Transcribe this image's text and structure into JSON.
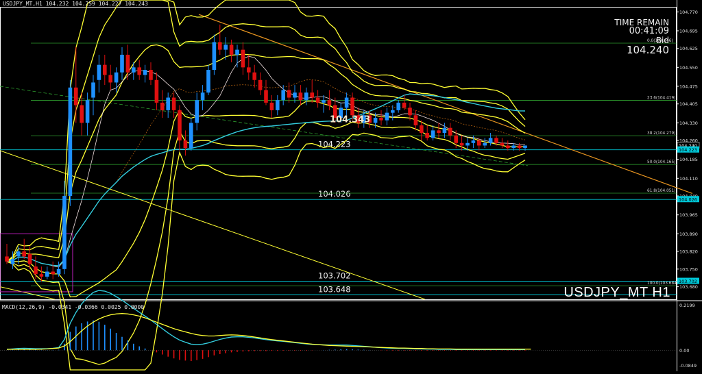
{
  "header": {
    "symbol_info": "USDJPY_MT,H1",
    "ohlc": "104.232 104.259 104.227 104.243"
  },
  "overlay": {
    "time_remain_label": "TIME REMAIN",
    "time_remain_value": "00:41:09",
    "bid_label": "Bid",
    "bid_value": "104.240",
    "symbol_watermark": "USDJPY_MT H1"
  },
  "colors": {
    "background": "#000000",
    "bull_candle": "#1e90ff",
    "bear_candle": "#e01010",
    "yellow_band": "#ffff33",
    "ma_cyan": "#33ccdd",
    "trendline_orange": "#e89520",
    "level_line_cyan": "#00c8d8",
    "fib_green": "#2e9e2e",
    "box_magenta": "#c020c0"
  },
  "chart_data": {
    "type": "candlestick",
    "price_axis": {
      "ylim": [
        103.63,
        104.79
      ],
      "tick_labels": [
        "104.770",
        "104.695",
        "104.625",
        "104.550",
        "104.475",
        "104.405",
        "104.330",
        "104.260",
        "104.185",
        "104.110",
        "104.040",
        "103.965",
        "103.890",
        "103.820",
        "103.750",
        "103.680"
      ]
    },
    "price_tags": [
      {
        "value": "104.240",
        "price": 104.24,
        "style": "bid"
      },
      {
        "value": "104.223",
        "price": 104.223,
        "style": "cyan"
      },
      {
        "value": "104.026",
        "price": 104.026,
        "style": "cyan"
      },
      {
        "value": "103.702",
        "price": 103.702,
        "style": "cyan"
      }
    ],
    "horizontal_levels": [
      {
        "label": "104.223",
        "price": 104.223
      },
      {
        "label": "104.026",
        "price": 104.026
      },
      {
        "label": "103.702",
        "price": 103.702
      },
      {
        "label": "103.648",
        "price": 103.648
      }
    ],
    "fibonacci_levels": [
      {
        "label": "0.0(104.646)",
        "price": 104.646
      },
      {
        "label": "23.6(104.419)",
        "price": 104.419
      },
      {
        "label": "38.2(104.279)",
        "price": 104.279
      },
      {
        "label": "50.0(104.165)",
        "price": 104.165
      },
      {
        "label": "61.8(104.051)",
        "price": 104.051
      },
      {
        "label": "100.0(103.684)",
        "price": 103.684
      }
    ],
    "annotation": {
      "text": "104.343",
      "price": 104.343
    },
    "candles": [
      {
        "o": 103.8,
        "h": 103.85,
        "l": 103.77,
        "c": 103.78
      },
      {
        "o": 103.77,
        "h": 103.82,
        "l": 103.75,
        "c": 103.79
      },
      {
        "o": 103.8,
        "h": 103.84,
        "l": 103.77,
        "c": 103.82
      },
      {
        "o": 103.82,
        "h": 103.87,
        "l": 103.79,
        "c": 103.8
      },
      {
        "o": 103.81,
        "h": 103.84,
        "l": 103.75,
        "c": 103.77
      },
      {
        "o": 103.76,
        "h": 103.8,
        "l": 103.71,
        "c": 103.73
      },
      {
        "o": 103.73,
        "h": 103.76,
        "l": 103.7,
        "c": 103.72
      },
      {
        "o": 103.72,
        "h": 103.76,
        "l": 103.71,
        "c": 103.74
      },
      {
        "o": 103.74,
        "h": 103.78,
        "l": 103.71,
        "c": 103.73
      },
      {
        "o": 103.73,
        "h": 103.78,
        "l": 103.72,
        "c": 103.75
      },
      {
        "o": 103.75,
        "h": 104.1,
        "l": 103.73,
        "c": 104.04
      },
      {
        "o": 104.04,
        "h": 104.5,
        "l": 104.0,
        "c": 104.47
      },
      {
        "o": 104.47,
        "h": 104.63,
        "l": 104.33,
        "c": 104.4
      },
      {
        "o": 104.4,
        "h": 104.45,
        "l": 104.28,
        "c": 104.33
      },
      {
        "o": 104.33,
        "h": 104.45,
        "l": 104.28,
        "c": 104.42
      },
      {
        "o": 104.43,
        "h": 104.52,
        "l": 104.36,
        "c": 104.49
      },
      {
        "o": 104.5,
        "h": 104.6,
        "l": 104.45,
        "c": 104.56
      },
      {
        "o": 104.56,
        "h": 104.6,
        "l": 104.48,
        "c": 104.52
      },
      {
        "o": 104.52,
        "h": 104.56,
        "l": 104.46,
        "c": 104.49
      },
      {
        "o": 104.49,
        "h": 104.55,
        "l": 104.45,
        "c": 104.53
      },
      {
        "o": 104.53,
        "h": 104.63,
        "l": 104.5,
        "c": 104.6
      },
      {
        "o": 104.6,
        "h": 104.64,
        "l": 104.5,
        "c": 104.53
      },
      {
        "o": 104.53,
        "h": 104.57,
        "l": 104.5,
        "c": 104.55
      },
      {
        "o": 104.55,
        "h": 104.58,
        "l": 104.5,
        "c": 104.52
      },
      {
        "o": 104.52,
        "h": 104.56,
        "l": 104.49,
        "c": 104.54
      },
      {
        "o": 104.54,
        "h": 104.57,
        "l": 104.48,
        "c": 104.5
      },
      {
        "o": 104.5,
        "h": 104.53,
        "l": 104.38,
        "c": 104.41
      },
      {
        "o": 104.41,
        "h": 104.46,
        "l": 104.35,
        "c": 104.38
      },
      {
        "o": 104.38,
        "h": 104.45,
        "l": 104.35,
        "c": 104.43
      },
      {
        "o": 104.43,
        "h": 104.45,
        "l": 104.35,
        "c": 104.38
      },
      {
        "o": 104.38,
        "h": 104.4,
        "l": 104.22,
        "c": 104.26
      },
      {
        "o": 104.26,
        "h": 104.3,
        "l": 104.2,
        "c": 104.23
      },
      {
        "o": 104.23,
        "h": 104.35,
        "l": 104.22,
        "c": 104.33
      },
      {
        "o": 104.33,
        "h": 104.45,
        "l": 104.3,
        "c": 104.42
      },
      {
        "o": 104.42,
        "h": 104.48,
        "l": 104.38,
        "c": 104.45
      },
      {
        "o": 104.45,
        "h": 104.56,
        "l": 104.44,
        "c": 104.54
      },
      {
        "o": 104.54,
        "h": 104.68,
        "l": 104.52,
        "c": 104.65
      },
      {
        "o": 104.65,
        "h": 104.72,
        "l": 104.6,
        "c": 104.62
      },
      {
        "o": 104.62,
        "h": 104.67,
        "l": 104.58,
        "c": 104.64
      },
      {
        "o": 104.64,
        "h": 104.66,
        "l": 104.57,
        "c": 104.6
      },
      {
        "o": 104.6,
        "h": 104.64,
        "l": 104.55,
        "c": 104.62
      },
      {
        "o": 104.62,
        "h": 104.65,
        "l": 104.52,
        "c": 104.55
      },
      {
        "o": 104.55,
        "h": 104.6,
        "l": 104.5,
        "c": 104.53
      },
      {
        "o": 104.53,
        "h": 104.56,
        "l": 104.47,
        "c": 104.5
      },
      {
        "o": 104.5,
        "h": 104.53,
        "l": 104.44,
        "c": 104.46
      },
      {
        "o": 104.46,
        "h": 104.5,
        "l": 104.4,
        "c": 104.41
      },
      {
        "o": 104.41,
        "h": 104.44,
        "l": 104.35,
        "c": 104.38
      },
      {
        "o": 104.38,
        "h": 104.44,
        "l": 104.36,
        "c": 104.42
      },
      {
        "o": 104.42,
        "h": 104.48,
        "l": 104.4,
        "c": 104.46
      },
      {
        "o": 104.46,
        "h": 104.49,
        "l": 104.41,
        "c": 104.43
      },
      {
        "o": 104.43,
        "h": 104.48,
        "l": 104.41,
        "c": 104.45
      },
      {
        "o": 104.45,
        "h": 104.48,
        "l": 104.4,
        "c": 104.42
      },
      {
        "o": 104.42,
        "h": 104.47,
        "l": 104.4,
        "c": 104.45
      },
      {
        "o": 104.45,
        "h": 104.5,
        "l": 104.41,
        "c": 104.43
      },
      {
        "o": 104.43,
        "h": 104.46,
        "l": 104.39,
        "c": 104.41
      },
      {
        "o": 104.41,
        "h": 104.44,
        "l": 104.37,
        "c": 104.42
      },
      {
        "o": 104.42,
        "h": 104.46,
        "l": 104.38,
        "c": 104.4
      },
      {
        "o": 104.4,
        "h": 104.43,
        "l": 104.33,
        "c": 104.35
      },
      {
        "o": 104.35,
        "h": 104.41,
        "l": 104.33,
        "c": 104.39
      },
      {
        "o": 104.39,
        "h": 104.45,
        "l": 104.36,
        "c": 104.43
      },
      {
        "o": 104.43,
        "h": 104.45,
        "l": 104.34,
        "c": 104.36
      },
      {
        "o": 104.36,
        "h": 104.39,
        "l": 104.31,
        "c": 104.33
      },
      {
        "o": 104.33,
        "h": 104.38,
        "l": 104.31,
        "c": 104.36
      },
      {
        "o": 104.36,
        "h": 104.38,
        "l": 104.31,
        "c": 104.33
      },
      {
        "o": 104.33,
        "h": 104.37,
        "l": 104.31,
        "c": 104.35
      },
      {
        "o": 104.35,
        "h": 104.38,
        "l": 104.32,
        "c": 104.34
      },
      {
        "o": 104.34,
        "h": 104.39,
        "l": 104.32,
        "c": 104.37
      },
      {
        "o": 104.37,
        "h": 104.4,
        "l": 104.34,
        "c": 104.38
      },
      {
        "o": 104.38,
        "h": 104.42,
        "l": 104.37,
        "c": 104.41
      },
      {
        "o": 104.41,
        "h": 104.44,
        "l": 104.38,
        "c": 104.39
      },
      {
        "o": 104.39,
        "h": 104.41,
        "l": 104.34,
        "c": 104.36
      },
      {
        "o": 104.36,
        "h": 104.38,
        "l": 104.3,
        "c": 104.32
      },
      {
        "o": 104.32,
        "h": 104.34,
        "l": 104.26,
        "c": 104.29
      },
      {
        "o": 104.29,
        "h": 104.32,
        "l": 104.26,
        "c": 104.27
      },
      {
        "o": 104.27,
        "h": 104.32,
        "l": 104.26,
        "c": 104.3
      },
      {
        "o": 104.3,
        "h": 104.33,
        "l": 104.27,
        "c": 104.29
      },
      {
        "o": 104.29,
        "h": 104.33,
        "l": 104.27,
        "c": 104.31
      },
      {
        "o": 104.31,
        "h": 104.33,
        "l": 104.26,
        "c": 104.28
      },
      {
        "o": 104.28,
        "h": 104.3,
        "l": 104.23,
        "c": 104.25
      },
      {
        "o": 104.25,
        "h": 104.28,
        "l": 104.22,
        "c": 104.24
      },
      {
        "o": 104.24,
        "h": 104.27,
        "l": 104.22,
        "c": 104.25
      },
      {
        "o": 104.25,
        "h": 104.28,
        "l": 104.23,
        "c": 104.26
      },
      {
        "o": 104.26,
        "h": 104.27,
        "l": 104.22,
        "c": 104.24
      },
      {
        "o": 104.24,
        "h": 104.27,
        "l": 104.23,
        "c": 104.25
      },
      {
        "o": 104.25,
        "h": 104.29,
        "l": 104.24,
        "c": 104.27
      },
      {
        "o": 104.27,
        "h": 104.28,
        "l": 104.24,
        "c": 104.25
      },
      {
        "o": 104.25,
        "h": 104.27,
        "l": 104.23,
        "c": 104.24
      },
      {
        "o": 104.24,
        "h": 104.26,
        "l": 104.22,
        "c": 104.23
      },
      {
        "o": 104.23,
        "h": 104.25,
        "l": 104.22,
        "c": 104.24
      },
      {
        "o": 104.24,
        "h": 104.25,
        "l": 104.22,
        "c": 104.23
      },
      {
        "o": 104.23,
        "h": 104.24,
        "l": 104.22,
        "c": 104.24
      }
    ],
    "macd": {
      "label": "MACD(12,26,9) -0.0341 -0.0366 0.0025 0.0000",
      "ylim": [
        -0.0849,
        0.2199
      ],
      "tick_labels": [
        "0.2199",
        "0.00",
        "-0.0849"
      ],
      "histogram": [
        0.0,
        0.002,
        0.004,
        0.005,
        0.004,
        0.003,
        0.002,
        0.001,
        0.001,
        0.002,
        0.03,
        0.085,
        0.11,
        0.125,
        0.133,
        0.138,
        0.132,
        0.118,
        0.1,
        0.08,
        0.062,
        0.045,
        0.03,
        0.018,
        0.008,
        0.0,
        -0.01,
        -0.02,
        -0.03,
        -0.038,
        -0.045,
        -0.048,
        -0.05,
        -0.046,
        -0.04,
        -0.032,
        -0.024,
        -0.018,
        -0.014,
        -0.01,
        -0.008,
        -0.006,
        -0.005,
        -0.004,
        -0.004,
        -0.004,
        -0.003,
        -0.003,
        -0.002,
        -0.002,
        -0.002,
        -0.002,
        -0.002,
        -0.001,
        0.0,
        0.001,
        0.002,
        0.003,
        0.004,
        0.005,
        0.004,
        0.003,
        0.002,
        0.001,
        0.0,
        -0.001,
        -0.002,
        -0.002,
        -0.002,
        -0.002,
        -0.002,
        -0.002,
        -0.002,
        -0.002,
        -0.002,
        -0.002,
        -0.002,
        -0.002,
        -0.002,
        -0.002,
        -0.002,
        -0.002,
        -0.002,
        -0.002,
        -0.002,
        -0.002,
        -0.002,
        -0.002,
        -0.002,
        -0.002,
        -0.002
      ],
      "signal": [
        0.004,
        0.004,
        0.004,
        0.004,
        0.004,
        0.004,
        0.005,
        0.006,
        0.008,
        0.01,
        0.02,
        0.04,
        0.065,
        0.09,
        0.112,
        0.13,
        0.145,
        0.156,
        0.164,
        0.168,
        0.17,
        0.168,
        0.164,
        0.158,
        0.15,
        0.14,
        0.13,
        0.12,
        0.11,
        0.1,
        0.092,
        0.085,
        0.078,
        0.072,
        0.068,
        0.066,
        0.066,
        0.068,
        0.07,
        0.071,
        0.07,
        0.068,
        0.065,
        0.061,
        0.057,
        0.053,
        0.049,
        0.046,
        0.043,
        0.04,
        0.037,
        0.034,
        0.031,
        0.028,
        0.026,
        0.024,
        0.022,
        0.021,
        0.02,
        0.019,
        0.018,
        0.017,
        0.016,
        0.015,
        0.014,
        0.013,
        0.012,
        0.011,
        0.01,
        0.01,
        0.009,
        0.008,
        0.008,
        0.007,
        0.007,
        0.006,
        0.006,
        0.006,
        0.005,
        0.005,
        0.005,
        0.005,
        0.005,
        0.005,
        0.005,
        0.005,
        0.005,
        0.005,
        0.005,
        0.005,
        0.005,
        0.005
      ]
    }
  }
}
